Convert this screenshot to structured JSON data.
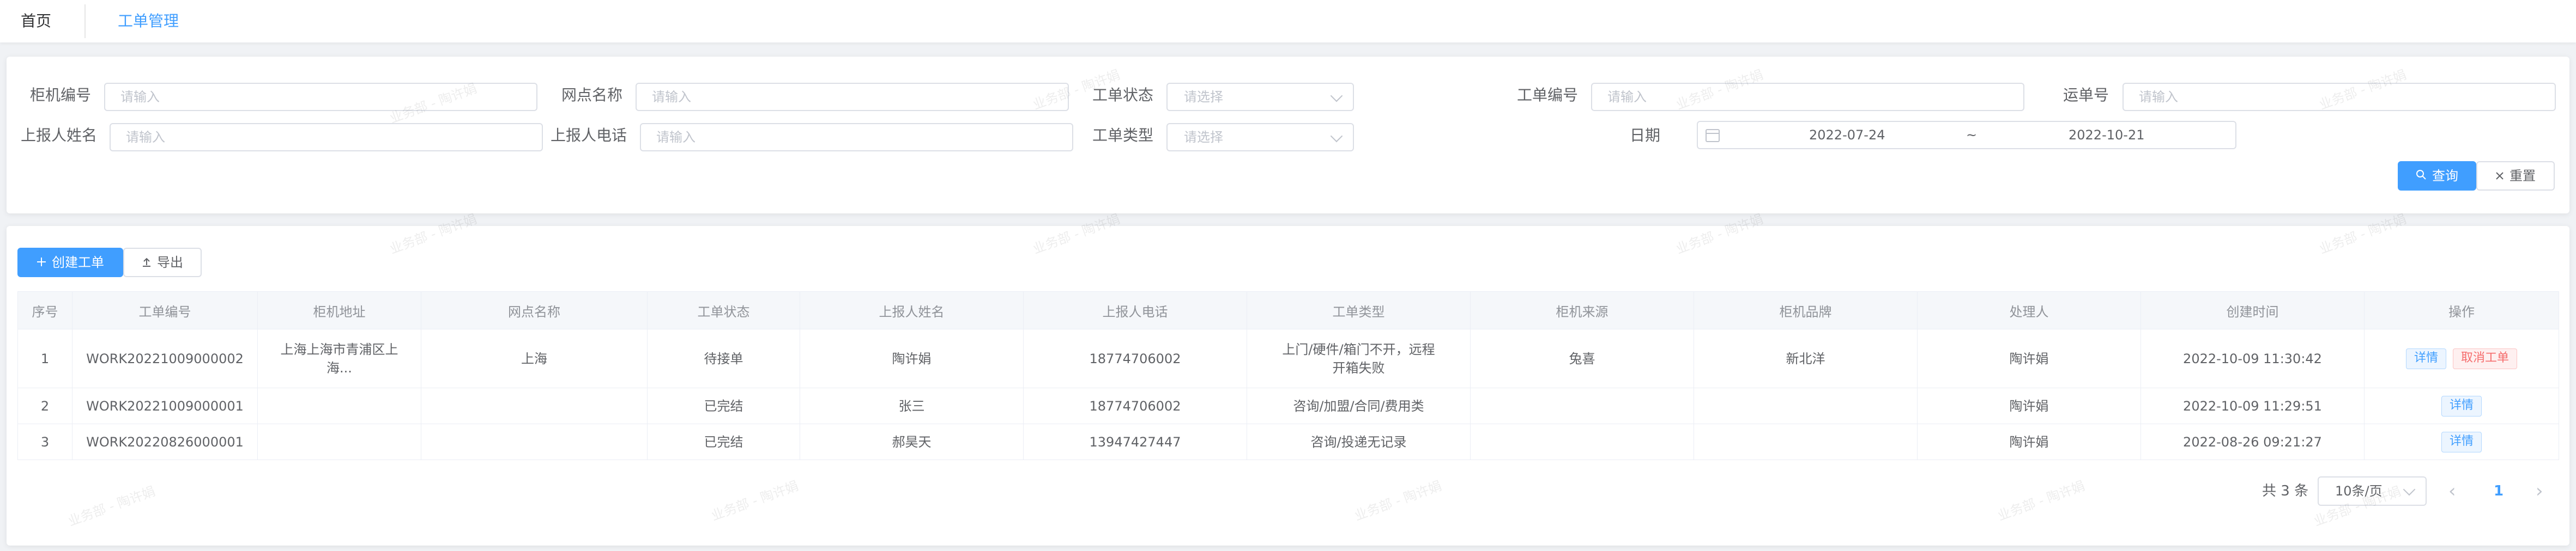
{
  "tabs": {
    "home": "首页",
    "active": "工单管理"
  },
  "filters": {
    "cabinet_no": {
      "label": "柜机编号",
      "placeholder": "请输入"
    },
    "site_name": {
      "label": "网点名称",
      "placeholder": "请输入"
    },
    "status": {
      "label": "工单状态",
      "placeholder": "请选择"
    },
    "order_no": {
      "label": "工单编号",
      "placeholder": "请输入"
    },
    "waybill_no": {
      "label": "运单号",
      "placeholder": "请输入"
    },
    "reporter_name": {
      "label": "上报人姓名",
      "placeholder": "请输入"
    },
    "reporter_phone": {
      "label": "上报人电话",
      "placeholder": "请输入"
    },
    "type": {
      "label": "工单类型",
      "placeholder": "请选择"
    },
    "date": {
      "label": "日期",
      "start": "2022-07-24",
      "separator": "~",
      "end": "2022-10-21"
    },
    "query_button": "查询",
    "reset_button": "重置"
  },
  "toolbar": {
    "create_button": "创建工单",
    "export_button": "导出"
  },
  "table": {
    "headers": [
      "序号",
      "工单编号",
      "柜机地址",
      "网点名称",
      "工单状态",
      "上报人姓名",
      "上报人电话",
      "工单类型",
      "柜机来源",
      "柜机品牌",
      "处理人",
      "创建时间",
      "操作"
    ],
    "rows": [
      {
        "index": "1",
        "order_no": "WORK20221009000002",
        "address": "上海上海市青浦区上海...",
        "site": "上海",
        "status": "待接单",
        "reporter": "陶许娟",
        "phone": "18774706002",
        "type": "上门/硬件/箱门不开，远程开箱失败",
        "source": "兔喜",
        "brand": "新北洋",
        "handler": "陶许娟",
        "created": "2022-10-09 11:30:42",
        "actions": [
          "详情",
          "取消工单"
        ]
      },
      {
        "index": "2",
        "order_no": "WORK20221009000001",
        "address": "",
        "site": "",
        "status": "已完结",
        "reporter": "张三",
        "phone": "18774706002",
        "type": "咨询/加盟/合同/费用类",
        "source": "",
        "brand": "",
        "handler": "陶许娟",
        "created": "2022-10-09 11:29:51",
        "actions": [
          "详情"
        ]
      },
      {
        "index": "3",
        "order_no": "WORK20220826000001",
        "address": "",
        "site": "",
        "status": "已完结",
        "reporter": "郝昊天",
        "phone": "13947427447",
        "type": "咨询/投递无记录",
        "source": "",
        "brand": "",
        "handler": "陶许娟",
        "created": "2022-08-26 09:21:27",
        "actions": [
          "详情"
        ]
      }
    ]
  },
  "pagination": {
    "total": "共 3 条",
    "page_size": "10条/页",
    "current": "1",
    "prev": "‹",
    "next": "›"
  },
  "watermark_text": "业务部 - 陶许娟",
  "colors": {
    "primary": "#409eff",
    "danger": "#f56c6c",
    "background": "#f0f2f5"
  }
}
